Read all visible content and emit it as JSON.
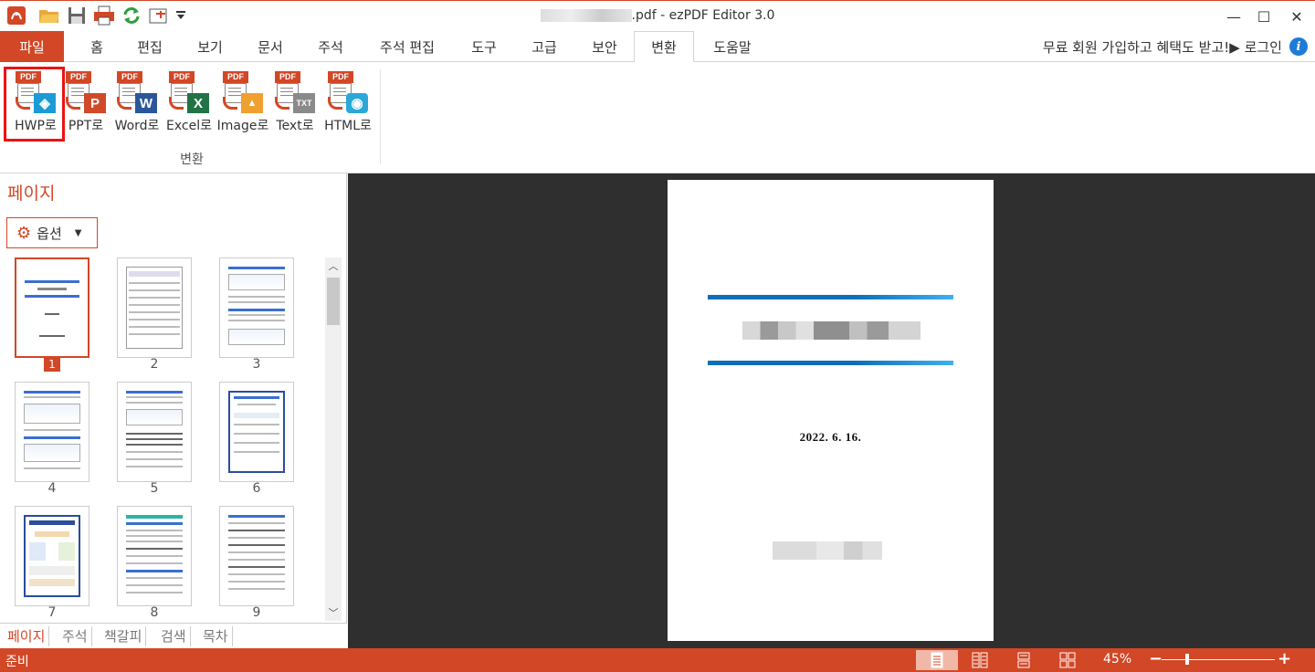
{
  "window": {
    "title_suffix": ".pdf - ezPDF Editor 3.0",
    "controls": {
      "minimize": "—",
      "maximize": "☐",
      "close": "✕"
    }
  },
  "quick_access": [
    "app-logo-icon",
    "open-folder-icon",
    "save-icon",
    "print-icon",
    "refresh-icon",
    "page-select-icon",
    "customize-icon"
  ],
  "tabs": {
    "file": "파일",
    "items": [
      "홈",
      "편집",
      "보기",
      "문서",
      "주석",
      "주석 편집",
      "도구",
      "고급",
      "보안",
      "변환",
      "도움말"
    ],
    "active": "변환",
    "promo": "무료 회원 가입하고 혜택도 받고!▶ 로그인"
  },
  "ribbon": {
    "group_label": "변환",
    "buttons": [
      {
        "label": "HWP로",
        "icon": "hwp-icon",
        "badge": "PDF",
        "glyph": "◈",
        "color": "#1a9bd7"
      },
      {
        "label": "PPT로",
        "icon": "ppt-icon",
        "badge": "PDF",
        "glyph": "P",
        "color": "#d04a2a"
      },
      {
        "label": "Word로",
        "icon": "word-icon",
        "badge": "PDF",
        "glyph": "W",
        "color": "#2b579a"
      },
      {
        "label": "Excel로",
        "icon": "excel-icon",
        "badge": "PDF",
        "glyph": "X",
        "color": "#217346"
      },
      {
        "label": "Image로",
        "icon": "image-icon",
        "badge": "PDF",
        "glyph": "▲",
        "color": "#f0a030"
      },
      {
        "label": "Text로",
        "icon": "text-icon",
        "badge": "PDF",
        "glyph": "TXT",
        "color": "#8a8a8a"
      },
      {
        "label": "HTML로",
        "icon": "html-icon",
        "badge": "PDF",
        "glyph": "◉",
        "color": "#2aa8d8"
      }
    ]
  },
  "left_panel": {
    "title": "페이지",
    "options_label": "옵션",
    "thumbnails": [
      "1",
      "2",
      "3",
      "4",
      "5",
      "6",
      "7",
      "8",
      "9"
    ],
    "selected_page": "1",
    "bottom_tabs": [
      "페이지",
      "주석",
      "책갈피",
      "검색",
      "목차"
    ]
  },
  "document": {
    "date": "2022.  6.  16."
  },
  "status": {
    "text": "준비",
    "zoom": "45%",
    "zoom_level_fraction": 0.25,
    "view_modes": [
      "single-page-view-icon",
      "two-page-view-icon",
      "continuous-view-icon",
      "grid-view-icon"
    ],
    "active_view": "single-page-view-icon"
  },
  "colors": {
    "accent": "#d24726",
    "highlight": "#ee1111",
    "doc_background": "#2f2f2f",
    "title_bar_blue": "#0f6fb6"
  }
}
